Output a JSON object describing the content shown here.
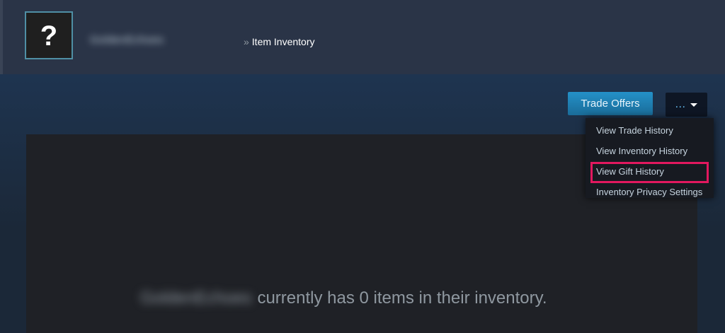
{
  "header": {
    "username": "GoldenEchoes",
    "breadcrumb_separator": "»",
    "breadcrumb_page": "Item Inventory",
    "avatar_glyph": "?"
  },
  "actions": {
    "trade_offers_label": "Trade Offers",
    "more_label": "..."
  },
  "dropdown": {
    "items": [
      {
        "label": "View Trade History"
      },
      {
        "label": "View Inventory History"
      },
      {
        "label": "View Gift History",
        "highlighted": true
      },
      {
        "label": "Inventory Privacy Settings"
      }
    ]
  },
  "inventory": {
    "owner_name": "GoldenEchoes",
    "empty_message": "currently has 0 items in their inventory."
  },
  "colors": {
    "highlight_border": "#e2185f",
    "accent_blue": "#66c0f4"
  }
}
